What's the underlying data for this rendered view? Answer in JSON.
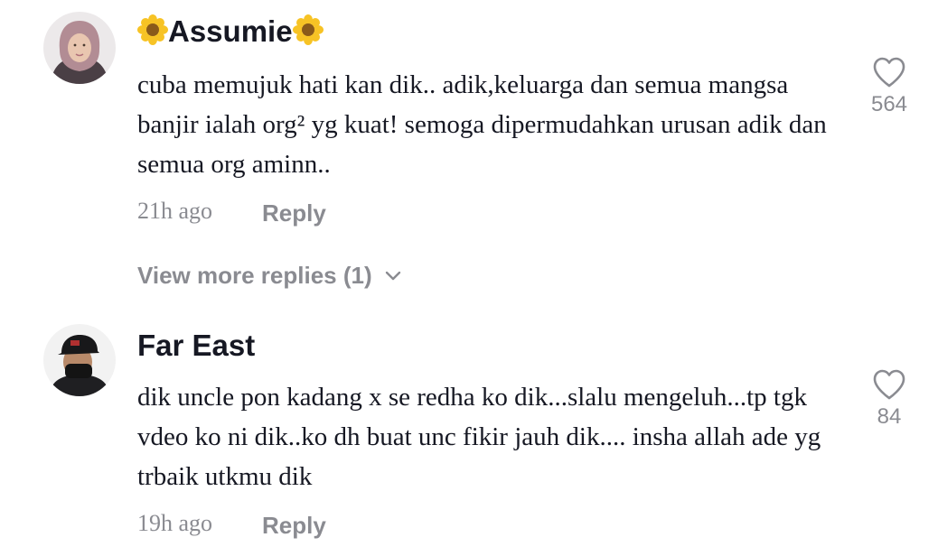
{
  "comments": [
    {
      "username": "Assumie",
      "username_decoration": "sunflower-emoji",
      "text": "cuba memujuk hati kan dik.. adik,keluarga dan semua mangsa banjir ialah org² yg kuat! semoga dipermudahkan urusan adik dan semua org aminn..",
      "time": "21h ago",
      "reply_label": "Reply",
      "like_count": "564",
      "view_more_label": "View more replies (1)"
    },
    {
      "username": "Far East",
      "text": "dik uncle pon kadang x se redha ko dik...slalu mengeluh...tp tgk vdeo ko ni dik..ko dh buat unc fikir jauh dik.... insha allah ade yg trbaik utkmu dik",
      "time": "19h ago",
      "reply_label": "Reply",
      "like_count": "84"
    }
  ],
  "colors": {
    "text_primary": "#161823",
    "text_secondary": "#8a8b91",
    "background": "#ffffff"
  }
}
